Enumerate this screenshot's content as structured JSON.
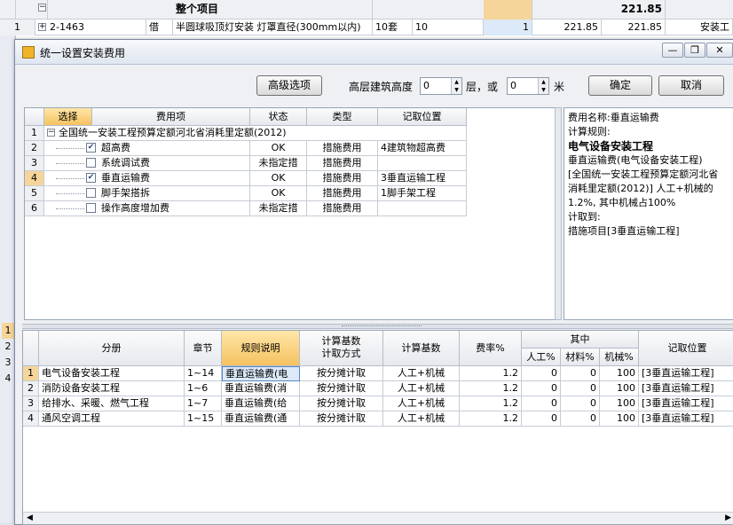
{
  "background": {
    "header": {
      "title": "整个项目",
      "total": "221.85"
    },
    "row": {
      "index": "1",
      "expander": "+",
      "code": "2-1463",
      "type": "借",
      "name": "半圆球吸顶灯安装 灯罩直径(300mm以内)",
      "unit": "10套",
      "qty": "10",
      "qty2": "1",
      "price": "221.85",
      "total": "221.85",
      "category": "安装工"
    },
    "left_numbers": [
      "1",
      "2",
      "3",
      "4"
    ]
  },
  "dialog": {
    "title": "统一设置安装费用",
    "window_buttons": {
      "minimize": "—",
      "restore": "❐",
      "close": "✕"
    },
    "advanced_button": "高级选项",
    "height_label": "高层建筑高度",
    "floors_value": "0",
    "floors_unit": "层，或",
    "meters_value": "0",
    "meters_unit": "米",
    "ok_button": "确定",
    "cancel_button": "取消"
  },
  "upper_table": {
    "headers": {
      "select": "选择",
      "fee_item": "费用项",
      "status": "状态",
      "type": "类型",
      "record": "记取位置"
    },
    "group": {
      "index": "1",
      "label": "全国统一安装工程预算定额河北省消耗里定额(2012)"
    },
    "rows": [
      {
        "index": "2",
        "checked": true,
        "name": "超高费",
        "status": "OK",
        "type": "措施费用",
        "record": "4建筑物超高费"
      },
      {
        "index": "3",
        "checked": false,
        "name": "系统调试费",
        "status": "未指定措",
        "type": "措施费用",
        "record": ""
      },
      {
        "index": "4",
        "checked": true,
        "name": "垂直运输费",
        "status": "OK",
        "type": "措施费用",
        "record": "3垂直运输工程"
      },
      {
        "index": "5",
        "checked": false,
        "name": "脚手架搭拆",
        "status": "OK",
        "type": "措施费用",
        "record": "1脚手架工程"
      },
      {
        "index": "6",
        "checked": false,
        "name": "操作高度增加费",
        "status": "未指定措",
        "type": "措施费用",
        "record": ""
      }
    ]
  },
  "info_panel": {
    "fee_name": "费用名称:垂直运输费",
    "rule_label": "计算规则:",
    "rule_title": "电气设备安装工程",
    "lines": [
      "垂直运输费(电气设备安装工程)",
      "[全国统一安装工程预算定额河北省",
      "消耗里定额(2012)] 人工+机械的",
      "1.2%, 其中机械占100%"
    ],
    "record_label": "计取到:",
    "record_value": "措施项目[3垂直运输工程]"
  },
  "lower_table": {
    "headers": {
      "section": "分册",
      "chapter": "章节",
      "rule": "规则说明",
      "calc_base_method_1": "计算基数",
      "calc_base_method_2": "计取方式",
      "calc_base": "计算基数",
      "rate": "费率%",
      "among": "其中",
      "labor": "人工%",
      "material": "材料%",
      "machine": "机械%",
      "record": "记取位置"
    },
    "rows": [
      {
        "index": "1",
        "section": "电气设备安装工程",
        "chapter": "1~14",
        "rule": "垂直运输费(电",
        "method": "按分摊计取",
        "base": "人工+机械",
        "rate": "1.2",
        "labor": "0",
        "material": "0",
        "machine": "100",
        "record": "[3垂直运输工程]"
      },
      {
        "index": "2",
        "section": "消防设备安装工程",
        "chapter": "1~6",
        "rule": "垂直运输费(消",
        "method": "按分摊计取",
        "base": "人工+机械",
        "rate": "1.2",
        "labor": "0",
        "material": "0",
        "machine": "100",
        "record": "[3垂直运输工程]"
      },
      {
        "index": "3",
        "section": "给排水、采暖、燃气工程",
        "chapter": "1~7",
        "rule": "垂直运输费(给",
        "method": "按分摊计取",
        "base": "人工+机械",
        "rate": "1.2",
        "labor": "0",
        "material": "0",
        "machine": "100",
        "record": "[3垂直运输工程]"
      },
      {
        "index": "4",
        "section": "通风空调工程",
        "chapter": "1~15",
        "rule": "垂直运输费(通",
        "method": "按分摊计取",
        "base": "人工+机械",
        "rate": "1.2",
        "labor": "0",
        "material": "0",
        "machine": "100",
        "record": "[3垂直运输工程]"
      }
    ]
  },
  "colors": {
    "accent_header": "#f5c260",
    "selected_cell": "#dbe9f8"
  }
}
